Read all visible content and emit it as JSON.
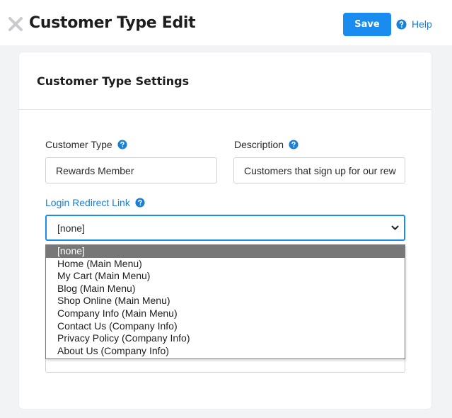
{
  "header": {
    "title": "Customer Type Edit",
    "save_label": "Save",
    "help_label": "Help"
  },
  "card": {
    "title": "Customer Type Settings"
  },
  "form": {
    "customer_type": {
      "label": "Customer Type",
      "value": "Rewards Member"
    },
    "description": {
      "label": "Description",
      "value": "Customers that sign up for our rew"
    },
    "login_redirect": {
      "label": "Login Redirect Link",
      "selected": "[none]",
      "options": [
        "[none]",
        "Home (Main Menu)",
        "My Cart (Main Menu)",
        "Blog (Main Menu)",
        "Shop Online (Main Menu)",
        "Company Info (Main Menu)",
        "Contact Us (Company Info)",
        "Privacy Policy (Company Info)",
        "About Us (Company Info)"
      ]
    }
  },
  "colors": {
    "accent": "#1a8cf0",
    "link": "#1a7fd6",
    "selected_option_bg": "#777777"
  },
  "icons": {
    "close": "close-icon",
    "help": "help-circle-icon",
    "question": "question-circle-icon",
    "dropdown": "chevron-down-icon"
  }
}
